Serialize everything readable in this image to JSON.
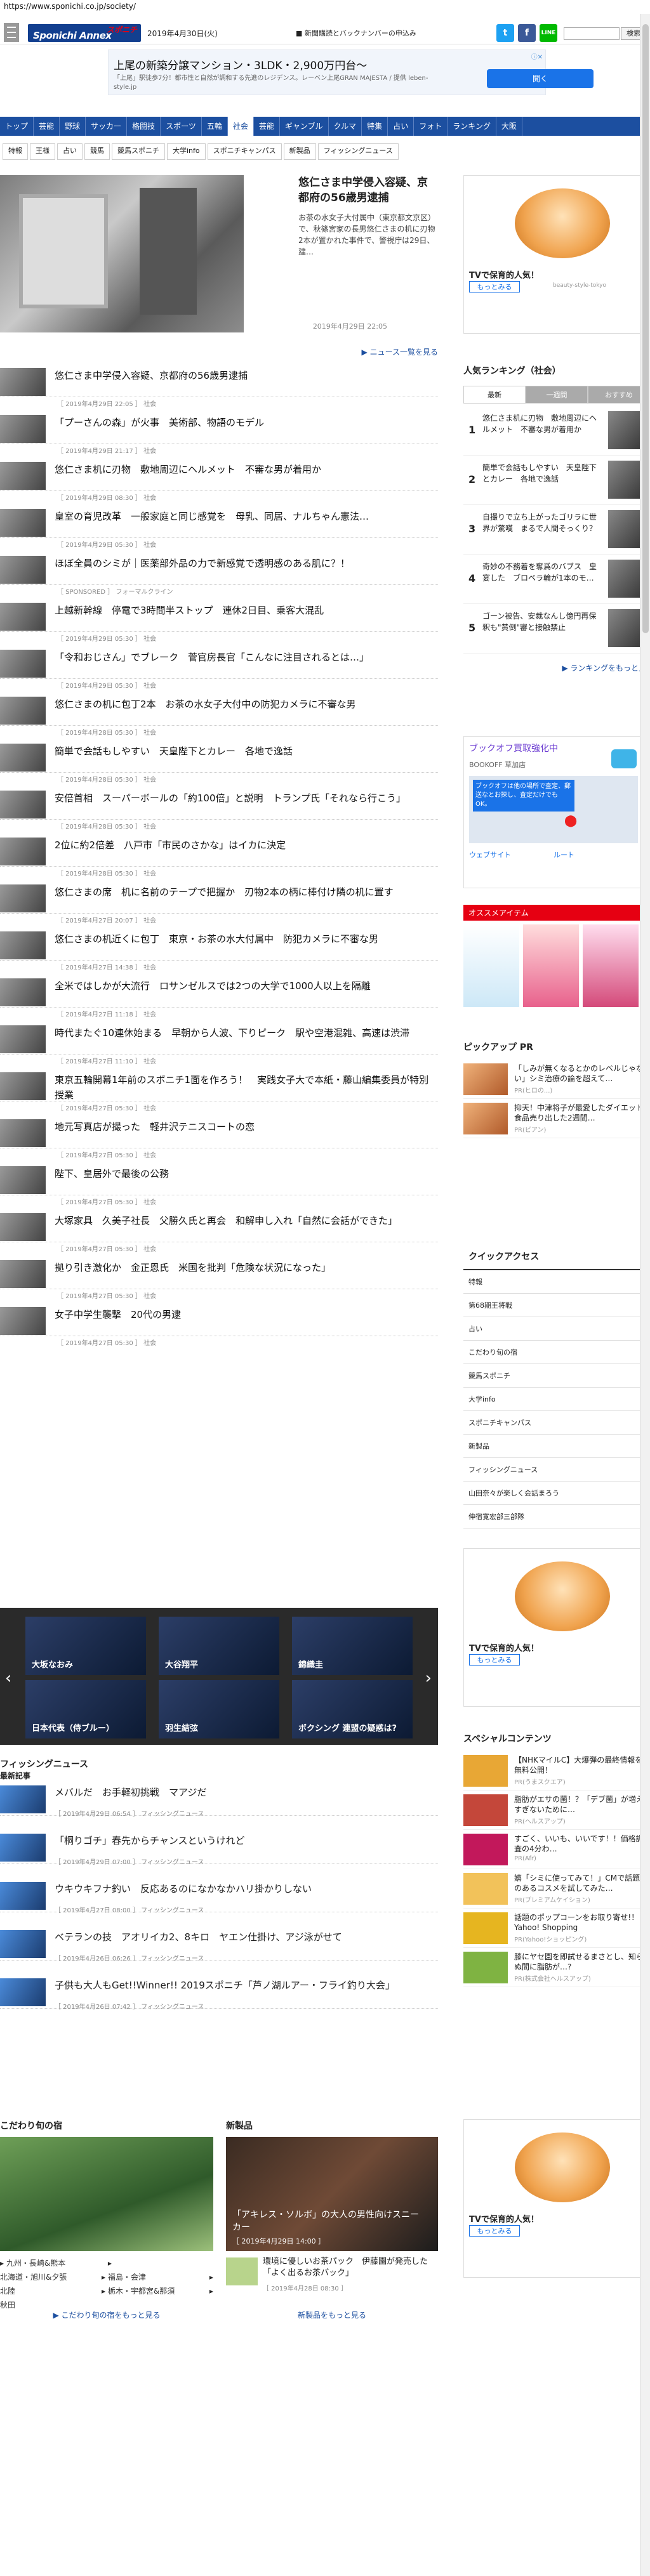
{
  "url": "https://www.sponichi.co.jp/society/",
  "header": {
    "logo_top": "スポニチ",
    "logo_main": "Sponichi Annex",
    "date": "2019年4月30日(火)",
    "link": "■ 新聞購読とバックナンバーの申込み",
    "search_btn": "検索"
  },
  "ad_top": {
    "headline": "上尾の新築分譲マンション・3LDK・2,900万円台～",
    "sub": "「上尾」駅徒歩7分！都市性と自然が調和する先進のレジデンス。レーベン上尾GRAN MAJESTA / 提供 leben-style.jp",
    "button": "開く",
    "close": "ⓘ✕"
  },
  "gnav": [
    "トップ",
    "芸能",
    "野球",
    "サッカー",
    "格闘技",
    "スポーツ",
    "五輪",
    "社会",
    "芸能",
    "ギャンブル",
    "クルマ",
    "特集",
    "占い",
    "フォト",
    "ランキング",
    "大阪"
  ],
  "gnav_on": 7,
  "snav": [
    "特報",
    "王様",
    "占い",
    "競馬",
    "競馬スポニチ",
    "大学info",
    "スポニチキャンパス",
    "新製品",
    "フィッシングニュース"
  ],
  "hero": {
    "title": "悠仁さま中学侵入容疑、京都府の56歳男逮捕",
    "desc": "お茶の水女子大付属中（東京都文京区）で、秋篠宮家の長男悠仁さまの机に刃物2本が置かれた事件で、警視庁は29日、建…",
    "date": "2019年4月29日 22:05",
    "more": "▶ ニュース一覧を見る"
  },
  "list": [
    {
      "title": "悠仁さま中学侵入容疑、京都府の56歳男逮捕",
      "meta": "［ 2019年4月29日 22:05 ］ 社会"
    },
    {
      "title": "「プーさんの森」が火事　美術部、物語のモデル",
      "meta": "［ 2019年4月29日 21:17 ］ 社会"
    },
    {
      "title": "悠仁さま机に刃物　敷地周辺にヘルメット　不審な男が着用か",
      "meta": "［ 2019年4月29日 08:30 ］ 社会"
    },
    {
      "title": "皇室の育児改革　一般家庭と同じ感覚を　母乳、同居、ナルちゃん憲法…",
      "meta": "［ 2019年4月29日 05:30 ］ 社会"
    },
    {
      "title": "ほぼ全員のシミが｜医薬部外品の力で新感覚で透明感のある肌に？！",
      "meta": "［ SPONSORED ］ フォーマルクライン"
    },
    {
      "title": "上越新幹線　停電で3時間半ストップ　連休2日目、乗客大混乱",
      "meta": "［ 2019年4月29日 05:30 ］ 社会"
    },
    {
      "title": "「令和おじさん」でブレーク　菅官房長官「こんなに注目されるとは…」",
      "meta": "［ 2019年4月29日 05:30 ］ 社会"
    },
    {
      "title": "悠仁さまの机に包丁2本　お茶の水女子大付中の防犯カメラに不審な男",
      "meta": "［ 2019年4月28日 05:30 ］ 社会"
    },
    {
      "title": "簡単で会話もしやすい　天皇陛下とカレー　各地で逸話",
      "meta": "［ 2019年4月28日 05:30 ］ 社会"
    },
    {
      "title": "安倍首相　スーパーボールの「約100倍」と説明　トランプ氏「それなら行こう」",
      "meta": "［ 2019年4月28日 05:30 ］ 社会"
    },
    {
      "title": "2位に約2倍差　八戸市「市民のさかな」はイカに決定",
      "meta": "［ 2019年4月28日 05:30 ］ 社会"
    },
    {
      "title": "悠仁さまの席　机に名前のテープで把握か　刃物2本の柄に棒付け隣の机に置す",
      "meta": "［ 2019年4月27日 20:07 ］ 社会"
    },
    {
      "title": "悠仁さまの机近くに包丁　東京・お茶の水大付属中　防犯カメラに不審な男",
      "meta": "［ 2019年4月27日 14:38 ］ 社会"
    },
    {
      "title": "全米ではしかが大流行　ロサンゼルスでは2つの大学で1000人以上を隔離",
      "meta": "［ 2019年4月27日 11:18 ］ 社会"
    },
    {
      "title": "時代またぐ10連休始まる　早朝から人波、下りピーク　駅や空港混雑、高速は渋滞",
      "meta": "［ 2019年4月27日 11:10 ］ 社会"
    },
    {
      "title": "東京五輪開幕1年前のスポニチ1面を作ろう！　実践女子大で本紙・藤山編集委員が特別授業",
      "meta": "［ 2019年4月27日 05:30 ］ 社会"
    },
    {
      "title": "地元写真店が撮った　軽井沢テニスコートの恋",
      "meta": "［ 2019年4月27日 05:30 ］ 社会"
    },
    {
      "title": "陛下、皇居外で最後の公務",
      "meta": "［ 2019年4月27日 05:30 ］ 社会"
    },
    {
      "title": "大塚家具　久美子社長　父勝久氏と再会　和解申し入れ「自然に会話ができた」",
      "meta": "［ 2019年4月27日 05:30 ］ 社会"
    },
    {
      "title": "拠り引き激化か　金正恩氏　米国を批判「危険な状況になった」",
      "meta": "［ 2019年4月27日 05:30 ］ 社会"
    },
    {
      "title": "女子中学生襲撃　20代の男逮",
      "meta": "［ 2019年4月27日 05:30 ］ 社会"
    }
  ],
  "slider": [
    "大坂なおみ",
    "大谷翔平",
    "錦織圭",
    "日本代表（侍ブルー）",
    "羽生結弦",
    "ボクシング 連盟の疑惑は?"
  ],
  "fishing": {
    "head": "フィッシングニュース",
    "sub": "最新記事",
    "items": [
      {
        "title": "メバルだ　お手軽初挑戦　マアジだ",
        "meta": "［ 2019年4月29日 06:54 ］ フィッシングニュース"
      },
      {
        "title": "「桐りゴチ」春先からチャンスというけれど",
        "meta": "［ 2019年4月29日 07:00 ］ フィッシングニュース"
      },
      {
        "title": "ウキウキフナ釣い　反応あるのになかなかハリ掛かりしない",
        "meta": "［ 2019年4月27日 08:00 ］ フィッシングニュース"
      },
      {
        "title": "ベテランの技　アオリイカ2、8キロ　ヤエン仕掛け、アジ泳がせて",
        "meta": "［ 2019年4月26日 06:26 ］ フィッシングニュース"
      },
      {
        "title": "子供も大人もGet!!Winner!! 2019スポニチ「芦ノ湖ルアー・フライ釣り大会」",
        "meta": "［ 2019年4月26日 07:42 ］ フィッシングニュース"
      }
    ]
  },
  "bottom": {
    "left_head": "こだわり旬の宿",
    "left_links": [
      "九州・長崎&熊本",
      "北海道・旭川&夕張",
      "福島・会津",
      "北陸",
      "栃木・宇都宮&那須",
      "秋田"
    ],
    "left_more": "▶ こだわり旬の宿をもっと見る",
    "right_head": "新製品",
    "right_cap": "「アキレス・ソルボ」の大人の男性向けスニーカー",
    "right_date": "［ 2019年4月29日 14:00 ］",
    "right_item": "環境に優しいお茶パック　伊藤園が発売した「よく出るお茶パック」",
    "right_item_date": "［ 2019年4月28日 08:30 ］",
    "right_more": "新製品をもっと見る"
  },
  "side": {
    "ad_text": "TVで保育的人気！",
    "ad_btn": "もっとみる",
    "ad_src": "beauty-style-tokyo",
    "rank_head": "人気ランキング（社会）",
    "rank_tabs": [
      "最新",
      "一週間",
      "おすすめ"
    ],
    "ranks": [
      {
        "n": "1",
        "t": "悠仁さま机に刃物　敷地周辺にヘルメット　不審な男が着用か"
      },
      {
        "n": "2",
        "t": "簡単で会話もしやすい　天皇陛下とカレー　各地で逸話"
      },
      {
        "n": "3",
        "t": "自撮りで立ち上がったゴリラに世界が驚嘆　まるで人間そっくり？"
      },
      {
        "n": "4",
        "t": "奇妙の不務着を奪爲のバブス　皇宴した　ブロベラ輪が1本のモ…"
      },
      {
        "n": "5",
        "t": "ゴーン被告、安裁なんし億円再保釈も\"黄倒\"審と接触禁止"
      }
    ],
    "rank_more": "▶ ランキングをもっと見",
    "map_head": "ブックオフ買取強化中",
    "map_sub": "BOOKOFF 草加店",
    "map_text": "ブックオフは他の場所で査定、郵送なとお探し、査定だけでもOK。",
    "map_btn1": "ウェブサイト",
    "map_btn2": "ルート",
    "osusume": "オススメアイテム",
    "pickup": "ピックアップ PR",
    "pickup_items": [
      {
        "t": "「しみが無くなるとかのレベルじゃない」シミ治療の論を超えて…",
        "p": "PR(ヒロの...)"
      },
      {
        "t": "抑天！中津将子が最愛したダイエット食品売り出した2週間…",
        "p": "PR(ビアン)"
      }
    ],
    "qa_head": "クイックアクセス",
    "qa": [
      "特報",
      "第68期王将戦",
      "占い",
      "こだわり旬の宿",
      "競馬スポニチ",
      "大学info",
      "スポニチキャンパス",
      "新製品",
      "フィッシングニュース",
      "山田奈々が楽しく会話まろう",
      "伸宿寛宏部三部隊"
    ],
    "sp_head": "スペシャルコンテンツ",
    "sp": [
      {
        "t": "【NHKマイルC】大爆弾の最終情報を無料公開！",
        "p": "PR(うまスクエア)"
      },
      {
        "t": "脂肪がエサの菌！？「デブ菌」が増えすぎないために…",
        "p": "PR(ヘルスアップ)"
      },
      {
        "t": "すごく、いいも、いいです！！価格調査の4分わ…",
        "p": "PR(Afr)"
      },
      {
        "t": "嬉「シミに使ってみて！」CMで話題のあるコスメを試してみた…",
        "p": "PR(プレミアムケイション)"
      },
      {
        "t": "話題のポップコーンをお取り寄せ!！Yahoo! Shopping",
        "p": "PR(Yahoo!ショッピング)"
      },
      {
        "t": "膝にヤセ園を即試せるまさとし、知らぬ間に脂肪が…?",
        "p": "PR(株式会社ヘルスアップ)"
      }
    ]
  }
}
